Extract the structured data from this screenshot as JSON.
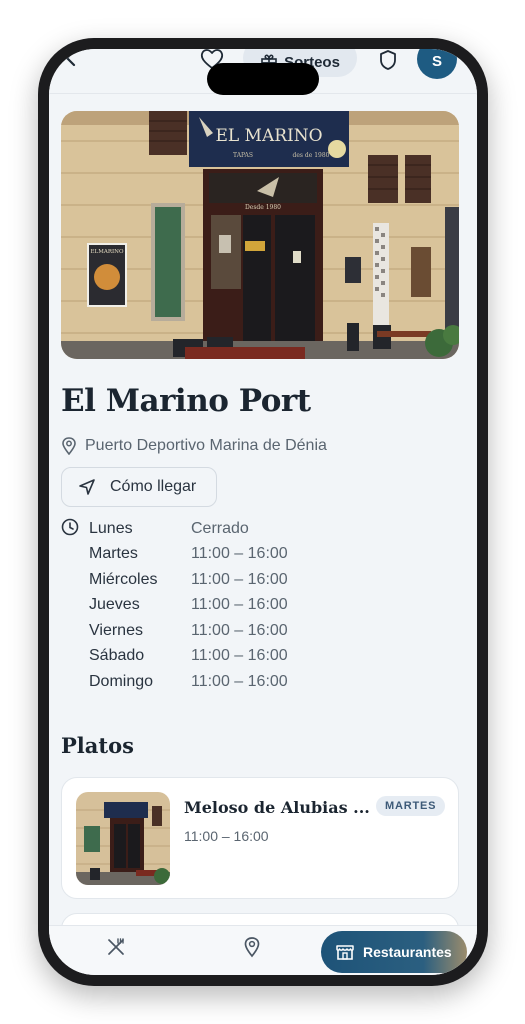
{
  "header": {
    "sorteos_label": "Sorteos",
    "avatar_initial": "S"
  },
  "hero": {
    "sign_text": "EL MARINO",
    "sign_sub_left": "TAPAS",
    "sign_sub_right": "des de 1980",
    "door_text": "Desde 1980",
    "poster_title": "ELMARINO"
  },
  "restaurant": {
    "name": "El Marino Port",
    "address": "Puerto Deportivo Marina de Dénia",
    "directions_label": "Cómo llegar",
    "hours": [
      {
        "day": "Lunes",
        "time": "Cerrado"
      },
      {
        "day": "Martes",
        "time": "11:00 – 16:00"
      },
      {
        "day": "Miércoles",
        "time": "11:00 – 16:00"
      },
      {
        "day": "Jueves",
        "time": "11:00 – 16:00"
      },
      {
        "day": "Viernes",
        "time": "11:00 – 16:00"
      },
      {
        "day": "Sábado",
        "time": "11:00 – 16:00"
      },
      {
        "day": "Domingo",
        "time": "11:00 – 16:00"
      }
    ]
  },
  "dishes_section": {
    "title": "Platos",
    "items": [
      {
        "name": "Meloso de Alubias ...",
        "badge": "MARTES",
        "time": "11:00 – 16:00"
      }
    ]
  },
  "bottom_nav": {
    "restaurants_label": "Restaurantes"
  },
  "colors": {
    "background": "#f2f5f8",
    "primary": "#1e5378",
    "badge_bg": "#e6ecf3",
    "text_dark": "#1b2530",
    "text_muted": "#5a6570"
  }
}
